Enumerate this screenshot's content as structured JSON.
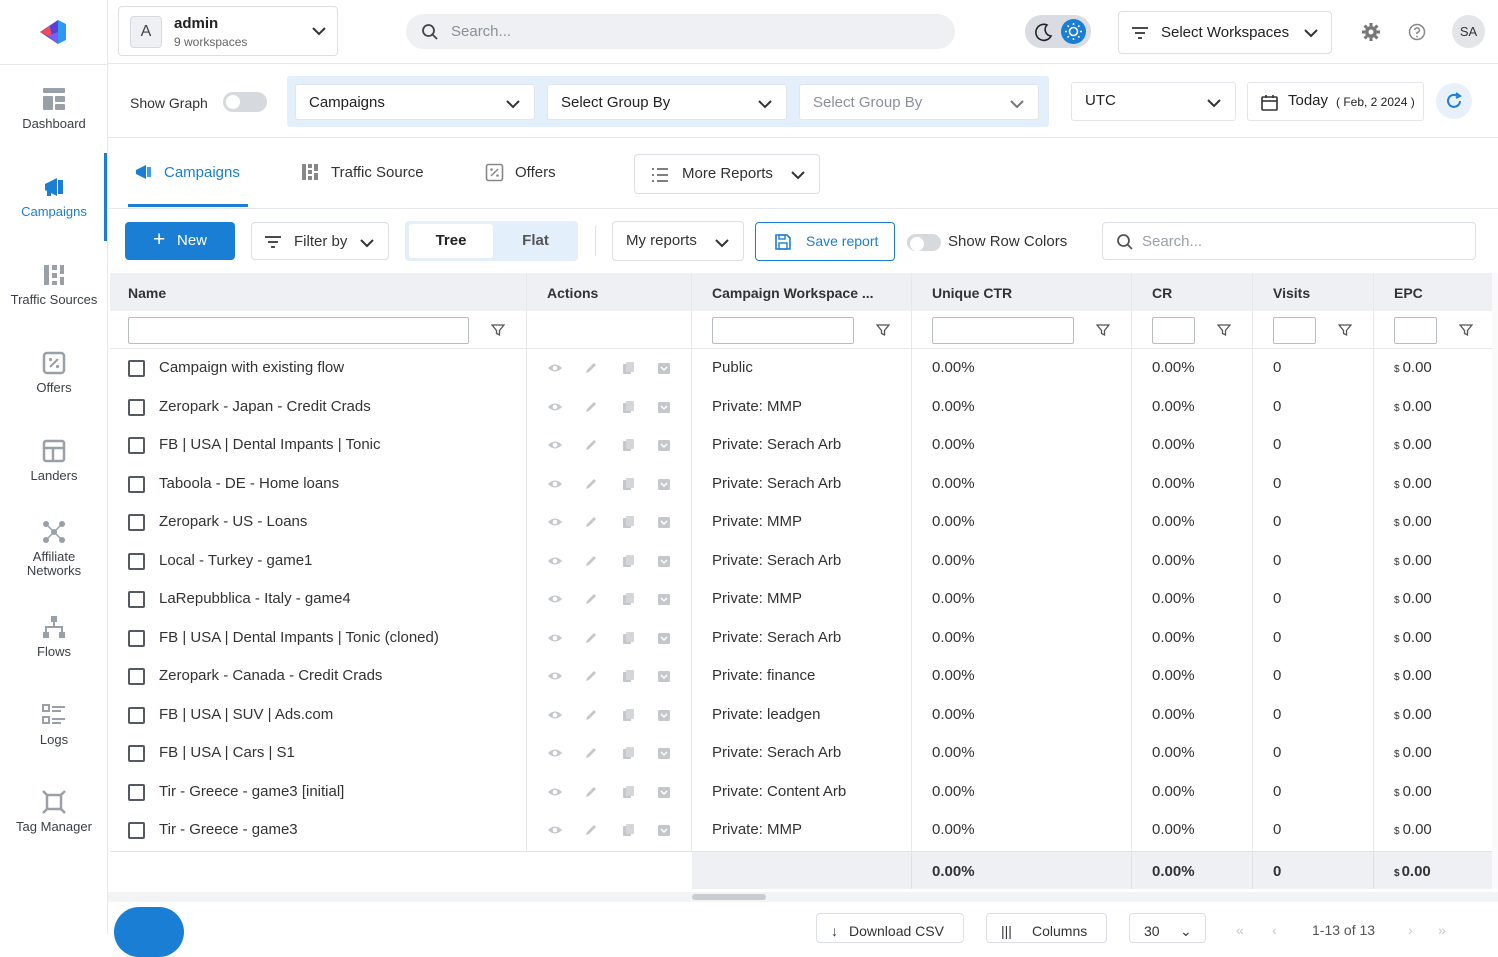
{
  "workspace": {
    "initial": "A",
    "name": "admin",
    "sub": "9 workspaces"
  },
  "top": {
    "search_placeholder": "Search...",
    "select_workspaces": "Select Workspaces",
    "avatar": "SA"
  },
  "sidebar": {
    "items": [
      {
        "label": "Dashboard"
      },
      {
        "label": "Campaigns"
      },
      {
        "label": "Traffic Sources"
      },
      {
        "label": "Offers"
      },
      {
        "label": "Landers"
      },
      {
        "label": "Affiliate Networks"
      },
      {
        "label": "Flows"
      },
      {
        "label": "Logs"
      },
      {
        "label": "Tag Manager"
      }
    ]
  },
  "filters": {
    "show_graph": "Show Graph",
    "group1": "Campaigns",
    "group2": "Select Group By",
    "group3": "Select Group By",
    "timezone": "UTC",
    "date_label": "Today",
    "date_value": "( Feb, 2 2024 )"
  },
  "tabs": {
    "campaigns": "Campaigns",
    "traffic_source": "Traffic Source",
    "offers": "Offers",
    "more_reports": "More Reports"
  },
  "toolbar": {
    "new": "New",
    "filter_by": "Filter by",
    "tree": "Tree",
    "flat": "Flat",
    "my_reports": "My reports",
    "save_report": "Save report",
    "show_row_colors": "Show Row Colors",
    "search_placeholder": "Search..."
  },
  "table": {
    "headers": {
      "name": "Name",
      "actions": "Actions",
      "workspace": "Campaign Workspace ...",
      "ctr": "Unique CTR",
      "cr": "CR",
      "visits": "Visits",
      "epc": "EPC"
    },
    "currency": "$",
    "rows": [
      {
        "name": "Campaign with existing flow",
        "workspace": "Public",
        "ctr": "0.00%",
        "cr": "0.00%",
        "visits": "0",
        "epc": "0.00"
      },
      {
        "name": "Zeropark - Japan - Credit Crads",
        "workspace": "Private: MMP",
        "ctr": "0.00%",
        "cr": "0.00%",
        "visits": "0",
        "epc": "0.00"
      },
      {
        "name": "FB | USA | Dental Impants | Tonic",
        "workspace": "Private: Serach Arb",
        "ctr": "0.00%",
        "cr": "0.00%",
        "visits": "0",
        "epc": "0.00"
      },
      {
        "name": "Taboola - DE - Home loans",
        "workspace": "Private: Serach Arb",
        "ctr": "0.00%",
        "cr": "0.00%",
        "visits": "0",
        "epc": "0.00"
      },
      {
        "name": "Zeropark - US - Loans",
        "workspace": "Private: MMP",
        "ctr": "0.00%",
        "cr": "0.00%",
        "visits": "0",
        "epc": "0.00"
      },
      {
        "name": "Local - Turkey - game1",
        "workspace": "Private: Serach Arb",
        "ctr": "0.00%",
        "cr": "0.00%",
        "visits": "0",
        "epc": "0.00"
      },
      {
        "name": "LaRepubblica - Italy - game4",
        "workspace": "Private: MMP",
        "ctr": "0.00%",
        "cr": "0.00%",
        "visits": "0",
        "epc": "0.00"
      },
      {
        "name": "FB | USA | Dental Impants | Tonic (cloned)",
        "workspace": "Private: Serach Arb",
        "ctr": "0.00%",
        "cr": "0.00%",
        "visits": "0",
        "epc": "0.00"
      },
      {
        "name": "Zeropark - Canada - Credit Crads",
        "workspace": "Private: finance",
        "ctr": "0.00%",
        "cr": "0.00%",
        "visits": "0",
        "epc": "0.00"
      },
      {
        "name": "FB | USA | SUV | Ads.com",
        "workspace": "Private: leadgen",
        "ctr": "0.00%",
        "cr": "0.00%",
        "visits": "0",
        "epc": "0.00"
      },
      {
        "name": "FB | USA | Cars | S1",
        "workspace": "Private: Serach Arb",
        "ctr": "0.00%",
        "cr": "0.00%",
        "visits": "0",
        "epc": "0.00"
      },
      {
        "name": "Tir - Greece - game3 [initial]",
        "workspace": "Private: Content Arb",
        "ctr": "0.00%",
        "cr": "0.00%",
        "visits": "0",
        "epc": "0.00"
      },
      {
        "name": "Tir - Greece - game3",
        "workspace": "Private: MMP",
        "ctr": "0.00%",
        "cr": "0.00%",
        "visits": "0",
        "epc": "0.00"
      }
    ],
    "totals": {
      "ctr": "0.00%",
      "cr": "0.00%",
      "visits": "0",
      "epc": "0.00"
    }
  },
  "footer": {
    "download_csv": "Download CSV",
    "columns": "Columns",
    "page_size": "30",
    "range": "1-13 of 13"
  },
  "colors": {
    "accent": "#1a7fd4",
    "header_bg": "#eef0f3"
  }
}
